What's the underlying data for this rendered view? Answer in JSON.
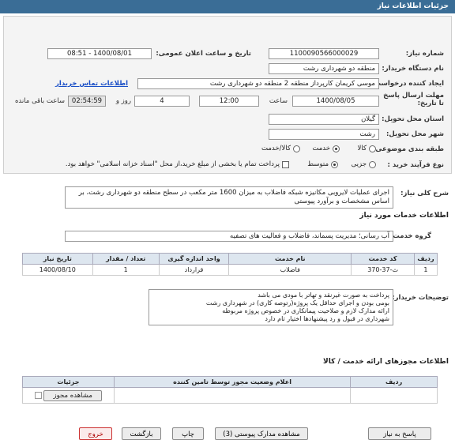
{
  "window": {
    "title": "جزئیات اطلاعات نیاز"
  },
  "need_number": {
    "label": "شماره نیاز:",
    "value": "1100090566000029"
  },
  "announce": {
    "label": "تاریخ و ساعت اعلان عمومی:",
    "value": "1400/08/01 - 08:51"
  },
  "buyer": {
    "label": "نام دستگاه خریدار:",
    "value": "منطقه دو شهرداری رشت"
  },
  "requester": {
    "label": "ایجاد کننده درخواست:",
    "value": "موسی کریمان کارپرداز منطقه 2 منطقه دو شهرداری رشت",
    "contact_link": "اطلاعات تماس خریدار"
  },
  "deadline": {
    "label": "مهلت ارسال پاسخ تا تاریخ:",
    "date": "1400/08/05",
    "time_label": "ساعت",
    "time": "12:00",
    "days": "4",
    "days_label": "روز و",
    "timer": "02:54:59",
    "remaining_label": "ساعت باقی مانده"
  },
  "province": {
    "label": "استان محل تحویل:",
    "value": "گیلان"
  },
  "city": {
    "label": "شهر محل تحویل:",
    "value": "رشت"
  },
  "category": {
    "label": "طبقه بندی موضوعی:",
    "options": [
      "کالا",
      "خدمت",
      "کالا/خدمت"
    ],
    "selected": "خدمت"
  },
  "purchase_type": {
    "label": "نوع فرآیند خرید :",
    "options": [
      "جزیی",
      "متوسط"
    ],
    "selected": "متوسط",
    "payment_note": "پرداخت تمام یا بخشی از مبلغ خرید،از محل \"اسناد خزانه اسلامی\" خواهد بود."
  },
  "summary": {
    "label": "شرح کلی نیاز:",
    "text": "اجرای عملیات لایروبی مکانیزه شبکه فاضلاب به میزان 1600 متر مکعب در سطح منطقه دو شهرداری رشت، بر اساس مشخصات و برآورد پیوستی"
  },
  "services_section": {
    "title": "اطلاعات خدمات مورد نیاز"
  },
  "service_group": {
    "label": "گروه خدمت:",
    "value": "آب رسانی؛ مدیریت پسماند، فاضلاب و فعالیت های تصفیه"
  },
  "table": {
    "headers": [
      "ردیف",
      "کد خدمت",
      "نام خدمت",
      "واحد اندازه گیری",
      "تعداد / مقدار",
      "تاریخ نیاز"
    ],
    "rows": [
      [
        "1",
        "ث-37-370",
        "فاضلاب",
        "قرارداد",
        "1",
        "1400/08/10"
      ]
    ]
  },
  "notes": {
    "label": "توضیحات خریدار:",
    "lines": [
      "پرداخت به صورت غیرنقد و تهاتر با مودی می باشد",
      "بومی بودن و اجرای حداقل یک پروژه(رتوصه کاری) در شهرداری رشت",
      "ارائه مدارک لازم و صلاحیت پیمانکاری در خصوص پروژه مربوطه",
      "شهرداری در قبول و رد پیشنهادها اختیار تام دارد"
    ]
  },
  "permits": {
    "title": "اطلاعات مجوزهای ارائه خدمت / کالا",
    "headers": [
      "ردیف",
      "اعلام وضعیت مجوز توسط تامین کننده",
      "جزئیات"
    ],
    "view_button": "مشاهده مجوز"
  },
  "buttons": {
    "reply": "پاسخ به نیاز",
    "attachments": "مشاهده مدارک پیوستی (3)",
    "print": "چاپ",
    "back": "بازگشت",
    "exit": "خروج"
  }
}
